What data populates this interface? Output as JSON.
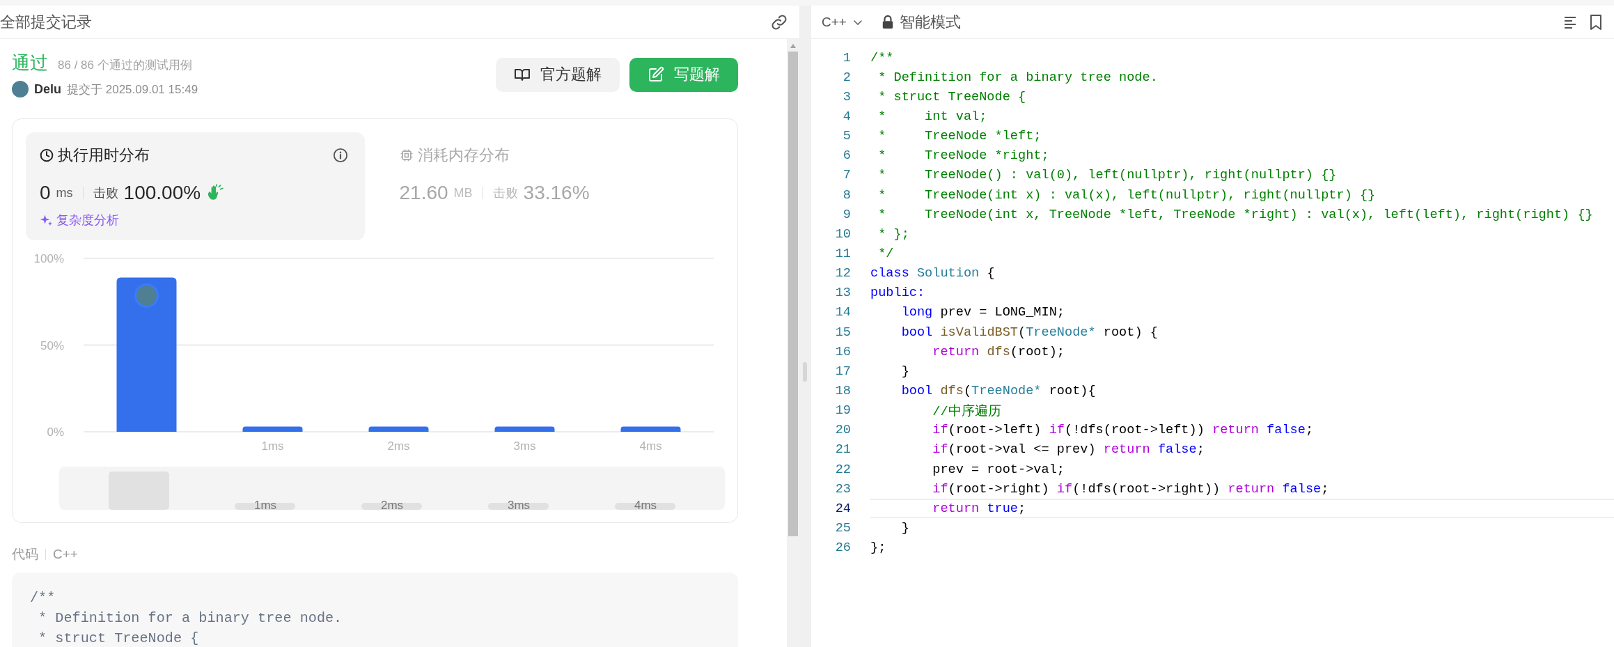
{
  "left_panel": {
    "title": "全部提交记录",
    "result": {
      "status": "通过",
      "passed": "86 / 86 个通过的测试用例",
      "user": "Delu",
      "submitted": "提交于 2025.09.01 15:49"
    },
    "buttons": [
      {
        "label": "官方题解",
        "kind": "secondary"
      },
      {
        "label": "写题解",
        "kind": "primary"
      }
    ],
    "metrics": [
      {
        "kind": "runtime",
        "title": "执行用时分布",
        "value": "0",
        "unit": "ms",
        "beats_label": "击败",
        "beats": "100.00%",
        "selected": true,
        "link": "复杂度分析"
      },
      {
        "kind": "memory",
        "title": "消耗内存分布",
        "value": "21.60",
        "unit": "MB",
        "beats_label": "击败",
        "beats": "33.16%",
        "selected": false
      }
    ],
    "chart_data": {
      "type": "bar",
      "x": [
        0,
        1,
        2,
        3,
        4
      ],
      "series": [
        {
          "color": "#3470ec",
          "values": [
            89,
            3,
            3,
            3,
            3
          ]
        }
      ],
      "xlim": [
        -0.5,
        4.5
      ],
      "ylim": [
        0,
        100
      ],
      "yticks": [
        {
          "value": 0,
          "label": "0%"
        },
        {
          "value": 50,
          "label": "50%"
        },
        {
          "value": 100,
          "label": "100%"
        }
      ],
      "xticks": [
        {
          "value": 1,
          "label": "1ms"
        },
        {
          "value": 2,
          "label": "2ms"
        },
        {
          "value": 3,
          "label": "3ms"
        },
        {
          "value": 4,
          "label": "4ms"
        }
      ]
    },
    "overview_labels": [
      "1ms",
      "2ms",
      "3ms",
      "4ms"
    ],
    "code_section": {
      "title": "代码",
      "language": "C++",
      "lines": [
        "/**",
        " * Definition for a binary tree node.",
        " * struct TreeNode {"
      ]
    }
  },
  "editor": {
    "language": "C++",
    "mode": "智能模式",
    "lines": [
      {
        "number": "1",
        "current": false,
        "tokens": [
          {
            "kind": "comment",
            "text": "/**"
          }
        ]
      },
      {
        "number": "2",
        "current": false,
        "tokens": [
          {
            "kind": "comment",
            "text": " * Definition for a binary tree node."
          }
        ]
      },
      {
        "number": "3",
        "current": false,
        "tokens": [
          {
            "kind": "comment",
            "text": " * struct TreeNode {"
          }
        ]
      },
      {
        "number": "4",
        "current": false,
        "tokens": [
          {
            "kind": "comment",
            "text": " *     int val;"
          }
        ]
      },
      {
        "number": "5",
        "current": false,
        "tokens": [
          {
            "kind": "comment",
            "text": " *     TreeNode *left;"
          }
        ]
      },
      {
        "number": "6",
        "current": false,
        "tokens": [
          {
            "kind": "comment",
            "text": " *     TreeNode *right;"
          }
        ]
      },
      {
        "number": "7",
        "current": false,
        "tokens": [
          {
            "kind": "comment",
            "text": " *     TreeNode() : val(0), left(nullptr), right(nullptr) {}"
          }
        ]
      },
      {
        "number": "8",
        "current": false,
        "tokens": [
          {
            "kind": "comment",
            "text": " *     TreeNode(int x) : val(x), left(nullptr), right(nullptr) {}"
          }
        ]
      },
      {
        "number": "9",
        "current": false,
        "tokens": [
          {
            "kind": "comment",
            "text": " *     TreeNode(int x, TreeNode *left, TreeNode *right) : val(x), left(left), right(right) {}"
          }
        ]
      },
      {
        "number": "10",
        "current": false,
        "tokens": [
          {
            "kind": "comment",
            "text": " * };"
          }
        ]
      },
      {
        "number": "11",
        "current": false,
        "tokens": [
          {
            "kind": "comment",
            "text": " */"
          }
        ]
      },
      {
        "number": "12",
        "current": false,
        "tokens": [
          {
            "kind": "keyword",
            "text": "class "
          },
          {
            "kind": "type",
            "text": "Solution"
          },
          {
            "kind": "plain",
            "text": " {"
          }
        ]
      },
      {
        "number": "13",
        "current": false,
        "tokens": [
          {
            "kind": "keyword",
            "text": "public:"
          }
        ]
      },
      {
        "number": "14",
        "current": false,
        "tokens": [
          {
            "kind": "keyword",
            "text": "    long"
          },
          {
            "kind": "plain",
            "text": " prev = LONG_MIN;"
          }
        ]
      },
      {
        "number": "15",
        "current": false,
        "tokens": [
          {
            "kind": "keyword",
            "text": "    bool "
          },
          {
            "kind": "function",
            "text": "isValidBST"
          },
          {
            "kind": "plain",
            "text": "("
          },
          {
            "kind": "type",
            "text": "TreeNode*"
          },
          {
            "kind": "plain",
            "text": " root) {"
          }
        ]
      },
      {
        "number": "16",
        "current": false,
        "tokens": [
          {
            "kind": "control",
            "text": "        return "
          },
          {
            "kind": "function",
            "text": "dfs"
          },
          {
            "kind": "plain",
            "text": "(root);"
          }
        ]
      },
      {
        "number": "17",
        "current": false,
        "tokens": [
          {
            "kind": "plain",
            "text": "    }"
          }
        ]
      },
      {
        "number": "18",
        "current": false,
        "tokens": [
          {
            "kind": "keyword",
            "text": "    bool "
          },
          {
            "kind": "function",
            "text": "dfs"
          },
          {
            "kind": "plain",
            "text": "("
          },
          {
            "kind": "type",
            "text": "TreeNode*"
          },
          {
            "kind": "plain",
            "text": " root){"
          }
        ]
      },
      {
        "number": "19",
        "current": false,
        "tokens": [
          {
            "kind": "comment",
            "text": "        //中序遍历"
          }
        ]
      },
      {
        "number": "20",
        "current": false,
        "tokens": [
          {
            "kind": "control",
            "text": "        if"
          },
          {
            "kind": "plain",
            "text": "(root->left) "
          },
          {
            "kind": "control",
            "text": "if"
          },
          {
            "kind": "plain",
            "text": "(!dfs(root->left)) "
          },
          {
            "kind": "control",
            "text": "return "
          },
          {
            "kind": "keyword",
            "text": "false"
          },
          {
            "kind": "plain",
            "text": ";"
          }
        ]
      },
      {
        "number": "21",
        "current": false,
        "tokens": [
          {
            "kind": "control",
            "text": "        if"
          },
          {
            "kind": "plain",
            "text": "(root->val <= prev) "
          },
          {
            "kind": "control",
            "text": "return "
          },
          {
            "kind": "keyword",
            "text": "false"
          },
          {
            "kind": "plain",
            "text": ";"
          }
        ]
      },
      {
        "number": "22",
        "current": false,
        "tokens": [
          {
            "kind": "plain",
            "text": "        prev = root->val;"
          }
        ]
      },
      {
        "number": "23",
        "current": false,
        "tokens": [
          {
            "kind": "control",
            "text": "        if"
          },
          {
            "kind": "plain",
            "text": "(root->right) "
          },
          {
            "kind": "control",
            "text": "if"
          },
          {
            "kind": "plain",
            "text": "(!dfs(root->right)) "
          },
          {
            "kind": "control",
            "text": "return "
          },
          {
            "kind": "keyword",
            "text": "false"
          },
          {
            "kind": "plain",
            "text": ";"
          }
        ]
      },
      {
        "number": "24",
        "current": true,
        "tokens": [
          {
            "kind": "control",
            "text": "        return "
          },
          {
            "kind": "keyword",
            "text": "true"
          },
          {
            "kind": "plain",
            "text": ";"
          }
        ]
      },
      {
        "number": "25",
        "current": false,
        "tokens": [
          {
            "kind": "plain",
            "text": "    }"
          }
        ]
      },
      {
        "number": "26",
        "current": false,
        "tokens": [
          {
            "kind": "plain",
            "text": "};"
          }
        ]
      }
    ]
  }
}
